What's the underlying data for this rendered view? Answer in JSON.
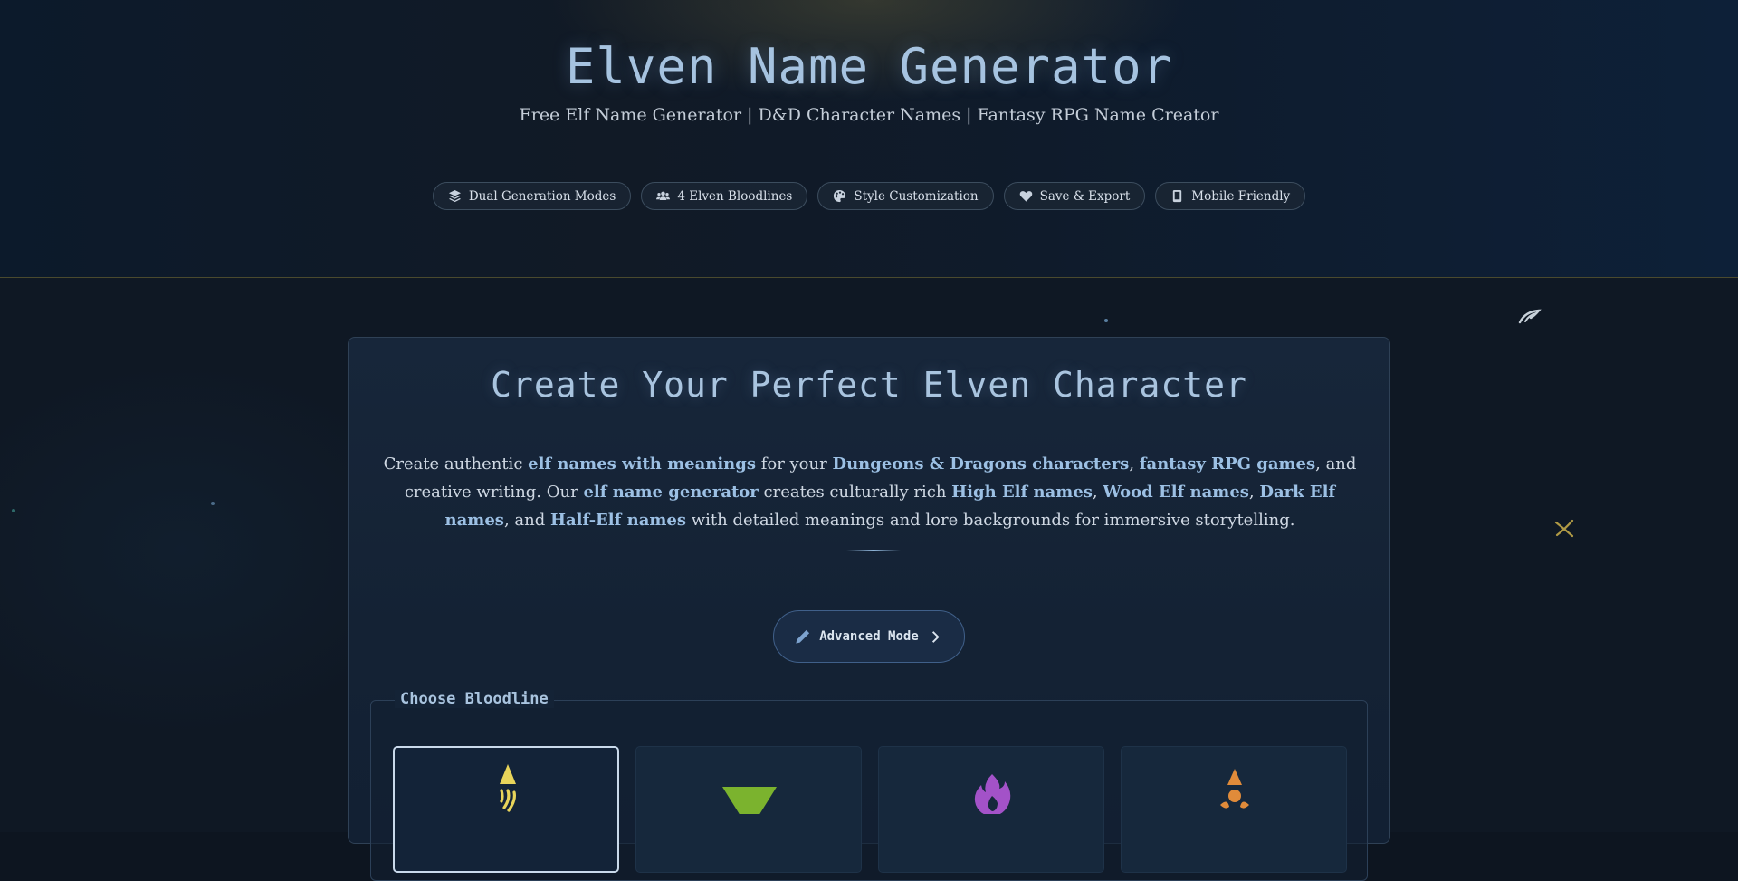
{
  "header": {
    "title": "Elven Name Generator",
    "subtitle": "Free Elf Name Generator | D&D Character Names | Fantasy RPG Name Creator"
  },
  "features": [
    {
      "label": "Dual Generation Modes",
      "icon": "layers-icon"
    },
    {
      "label": "4 Elven Bloodlines",
      "icon": "users-icon"
    },
    {
      "label": "Style Customization",
      "icon": "palette-icon"
    },
    {
      "label": "Save & Export",
      "icon": "heart-icon"
    },
    {
      "label": "Mobile Friendly",
      "icon": "mobile-icon"
    }
  ],
  "main": {
    "title": "Create Your Perfect Elven Character",
    "intro": {
      "t1": "Create authentic ",
      "b1": "elf names with meanings",
      "t2": " for your ",
      "b2": "Dungeons & Dragons characters",
      "t3": ", ",
      "b3": "fantasy RPG games",
      "t4": ", and creative writing. Our ",
      "b4": "elf name generator",
      "t5": " creates culturally rich ",
      "b5": "High Elf names",
      "t6": ", ",
      "b6": "Wood Elf names",
      "t7": ", ",
      "b7": "Dark Elf names",
      "t8": ", and ",
      "b8": "Half-Elf names",
      "t9": " with detailed meanings and lore backgrounds for immersive storytelling."
    },
    "advanced_button": "Advanced Mode",
    "bloodline": {
      "legend": "Choose Bloodline",
      "options": [
        {
          "icon": "high-elf-icon",
          "color": "#e8d45a",
          "selected": true
        },
        {
          "icon": "wood-elf-icon",
          "color": "#7bb32e",
          "selected": false
        },
        {
          "icon": "dark-elf-icon",
          "color": "#a352c8",
          "selected": false
        },
        {
          "icon": "half-elf-icon",
          "color": "#e08b3a",
          "selected": false
        }
      ]
    }
  },
  "colors": {
    "accent": "#a6c3e0",
    "highlight": "#9cc0e4",
    "background": "#0d1520"
  }
}
